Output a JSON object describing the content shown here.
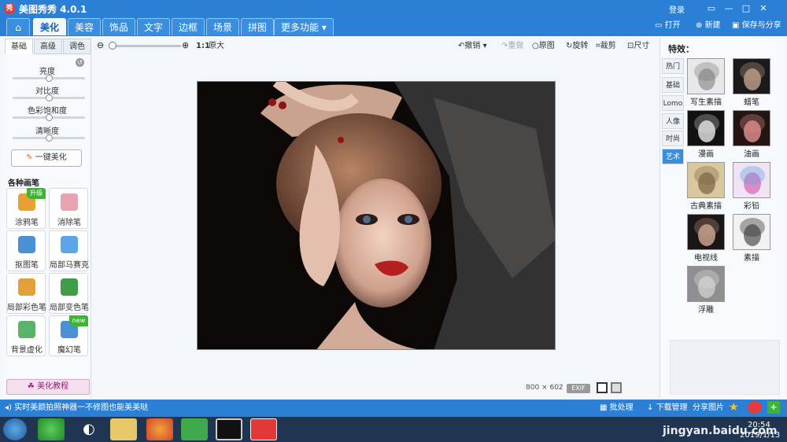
{
  "window": {
    "app_logo": "秀",
    "title": "美图秀秀 4.0.1",
    "login": "登录",
    "controls": [
      "▭",
      "—",
      "□",
      "✕"
    ]
  },
  "nav": {
    "home_icon": "⌂",
    "tabs": [
      "美化",
      "美容",
      "饰品",
      "文字",
      "边框",
      "场景",
      "拼图",
      "更多功能 ▾"
    ],
    "active": "美化",
    "open": "打开",
    "new": "新建",
    "save_share": "保存与分享"
  },
  "left": {
    "tabs": [
      "基础",
      "高级",
      "调色"
    ],
    "sliders": [
      {
        "label": "亮度",
        "value": 0.5
      },
      {
        "label": "对比度",
        "value": 0.5
      },
      {
        "label": "色彩饱和度",
        "value": 0.5
      },
      {
        "label": "清晰度",
        "value": 0.5
      }
    ],
    "one_click": "一键美化",
    "brush_heading": "各种画笔",
    "tools": [
      {
        "label": "涂鸦笔",
        "badge": "升级",
        "color": "#e8a030"
      },
      {
        "label": "消除笔",
        "badge": "",
        "color": "#e9a2b0"
      },
      {
        "label": "抠图笔",
        "badge": "",
        "color": "#4b8fd6"
      },
      {
        "label": "局部马赛克",
        "badge": "",
        "color": "#5aa6e6"
      },
      {
        "label": "局部彩色笔",
        "badge": "",
        "color": "#e2a03a"
      },
      {
        "label": "局部变色笔",
        "badge": "",
        "color": "#3f9d4a"
      },
      {
        "label": "背景虚化",
        "badge": "",
        "color": "#5bb36a"
      },
      {
        "label": "魔幻笔",
        "badge": "new",
        "color": "#4b8fd6"
      }
    ],
    "tutorial": "美化教程"
  },
  "toolbar": {
    "zoom_ratio": "1:1",
    "original_size": "原大",
    "undo": "撤销",
    "redo": "重做",
    "original": "原图",
    "rotate": "旋转",
    "crop": "裁剪",
    "size": "尺寸"
  },
  "canvas": {
    "width": "800",
    "times": "×",
    "height": "602",
    "exif": "EXIF"
  },
  "right": {
    "heading": "特效：",
    "tabs": [
      "热门",
      "基础",
      "Lomo",
      "人像",
      "时尚",
      "艺术"
    ],
    "active_tab": "艺术",
    "effects": [
      {
        "label": "写生素描",
        "bg": "#e8e8e8",
        "fg": "#777777"
      },
      {
        "label": "蜡笔",
        "bg": "#1a1a1a",
        "fg": "#b89a86"
      },
      {
        "label": "漫画",
        "bg": "#111111",
        "fg": "#dddddd"
      },
      {
        "label": "油画",
        "bg": "#241414",
        "fg": "#d88a88"
      },
      {
        "label": "古典素描",
        "bg": "#d9c79d",
        "fg": "#7a6444"
      },
      {
        "label": "彩铅",
        "bg": "#f0e4f4",
        "fg": "#d24fa8"
      },
      {
        "label": "电视线",
        "bg": "#1a1616",
        "fg": "#c9a08c"
      },
      {
        "label": "素描",
        "bg": "#f2f2f2",
        "fg": "#333333"
      },
      {
        "label": "浮雕",
        "bg": "#8f8f8f",
        "fg": "#d5d5d5"
      }
    ]
  },
  "status": {
    "message": "实时美颜拍照神器一不修图也能美美哒",
    "batch": "批处理",
    "downloads": "下载管理",
    "share": "分享图片"
  },
  "taskbar": {
    "watermark": "jingyan.baidu.com",
    "time": "20:54",
    "date": "2019/1/13"
  }
}
